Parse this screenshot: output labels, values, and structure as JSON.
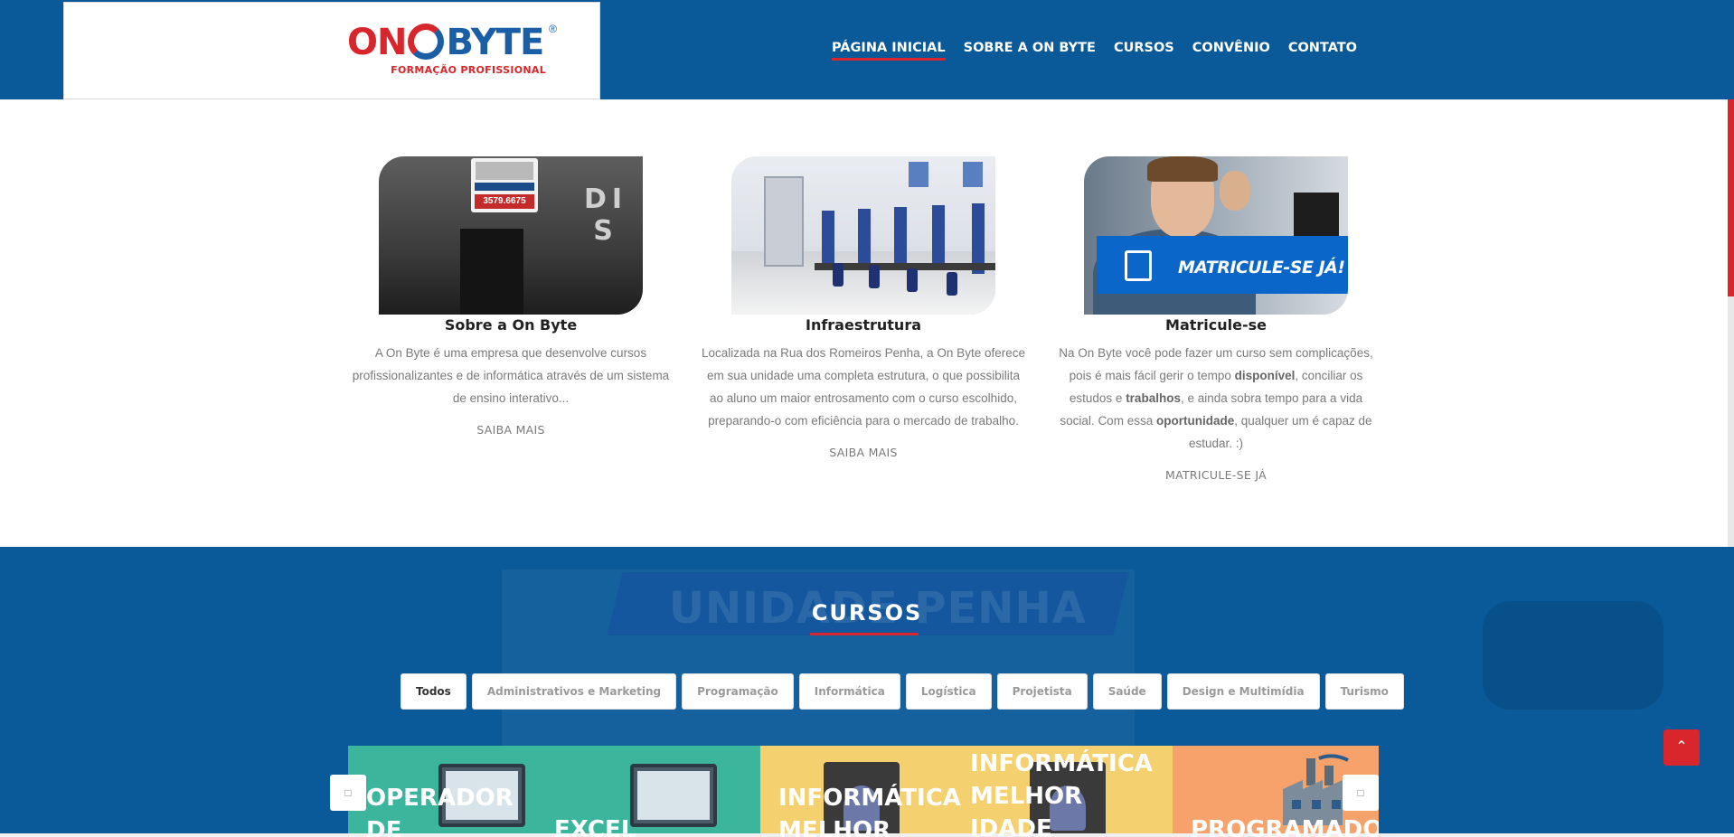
{
  "header": {
    "logo": {
      "main_left": "ON",
      "main_right": "BYTE",
      "registered": "®",
      "sub": "FORMAÇÃO PROFISSIONAL"
    },
    "nav": [
      {
        "label": "PÁGINA INICIAL",
        "active": true
      },
      {
        "label": "SOBRE A ON BYTE",
        "active": false
      },
      {
        "label": "CURSOS",
        "active": false
      },
      {
        "label": "CONVÊNIO",
        "active": false
      },
      {
        "label": "CONTATO",
        "active": false
      }
    ]
  },
  "features": [
    {
      "title": "Sobre a On Byte",
      "text": "A On Byte é uma empresa que desenvolve cursos profissionalizantes e de informática através de um sistema de ensino interativo...",
      "link": "SAIBA MAIS",
      "image": {
        "sign_number": "3579.6675",
        "letters": "DI S"
      }
    },
    {
      "title": "Infraestrutura",
      "text": "Localizada na Rua dos Romeiros Penha, a On Byte oferece em sua unidade uma completa estrutura, o que possibilita ao aluno um maior entrosamento com o curso escolhido, preparando-o com eficiência para o mercado de trabalho.",
      "link": "SAIBA MAIS"
    },
    {
      "title": "Matricule-se",
      "text_parts": {
        "p1": "Na On Byte você pode fazer um curso sem complicações, pois é mais fácil gerir o tempo ",
        "b1": "disponível",
        "p2": ", conciliar os estudos e ",
        "b2": "trabalhos",
        "p3": ", e ainda sobra tempo para a vida social. Com essa ",
        "b3": "oportunidade",
        "p4": ", qualquer um é capaz de estudar. :)"
      },
      "link": "MATRICULE-SE JÁ",
      "image": {
        "banner": "MATRICULE-SE JÁ!"
      }
    }
  ],
  "cursos": {
    "title": "CURSOS",
    "background_text": "UNIDADE PENHA",
    "filters": [
      {
        "label": "Todos",
        "active": true
      },
      {
        "label": "Administrativos e Marketing",
        "active": false
      },
      {
        "label": "Programação",
        "active": false
      },
      {
        "label": "Informática",
        "active": false
      },
      {
        "label": "Logística",
        "active": false
      },
      {
        "label": "Projetista",
        "active": false
      },
      {
        "label": "Saúde",
        "active": false
      },
      {
        "label": "Design e Multimídia",
        "active": false
      },
      {
        "label": "Turismo",
        "active": false
      }
    ],
    "cards": [
      {
        "title": "OPERADOR\nDE",
        "color": "#3bb59c"
      },
      {
        "title": "EXCEL",
        "color": "#3bb59c"
      },
      {
        "title": "INFORMÁTICA\nMELHOR",
        "color": "#f4d06f"
      },
      {
        "title": "INFORMÁTICA\nMELHOR\nIDADE",
        "color": "#f4d06f"
      },
      {
        "title": "PROGRAMADO",
        "color": "#f7a26a"
      }
    ],
    "prev_icon": "chevron-left-icon",
    "next_icon": "chevron-right-icon"
  },
  "back_to_top_icon": "chevron-up-icon",
  "colors": {
    "primary": "#0a5a9a",
    "accent": "#d8262c"
  }
}
